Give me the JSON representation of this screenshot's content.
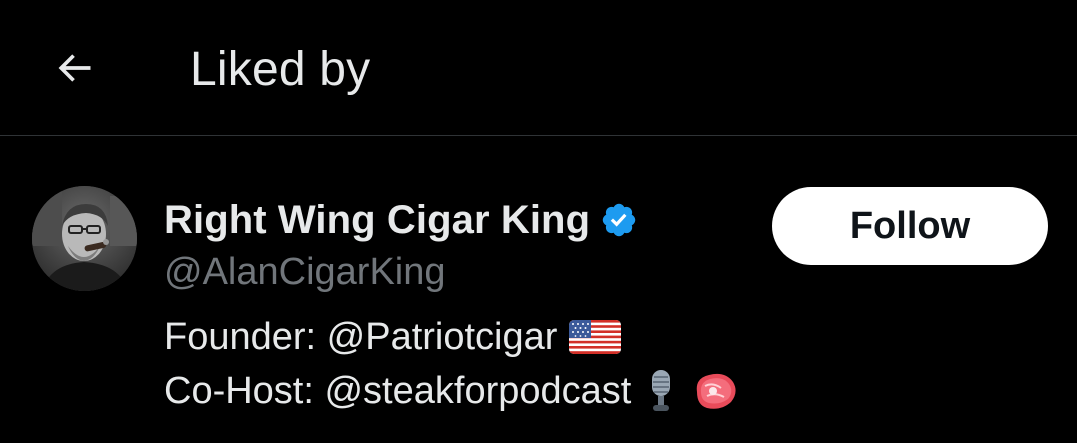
{
  "header": {
    "back_icon": "arrow-left-icon",
    "title": "Liked by"
  },
  "user": {
    "display_name": "Right Wing Cigar King",
    "verified_icon": "verified-badge-icon",
    "handle": "@AlanCigarKing",
    "bio_lines": [
      "Founder: @Patriotcigar",
      "Co-Host: @steakforpodcast"
    ],
    "bio_emojis": [
      "us-flag-emoji",
      "microphone-emoji",
      "steak-emoji"
    ],
    "follow_label": "Follow"
  },
  "colors": {
    "background": "#000000",
    "primary_text": "#e7e9ea",
    "secondary_text": "#71767b",
    "divider": "#2f3336",
    "verified_blue": "#1d9bf0",
    "follow_bg": "#ffffff",
    "follow_text": "#0f1419"
  }
}
